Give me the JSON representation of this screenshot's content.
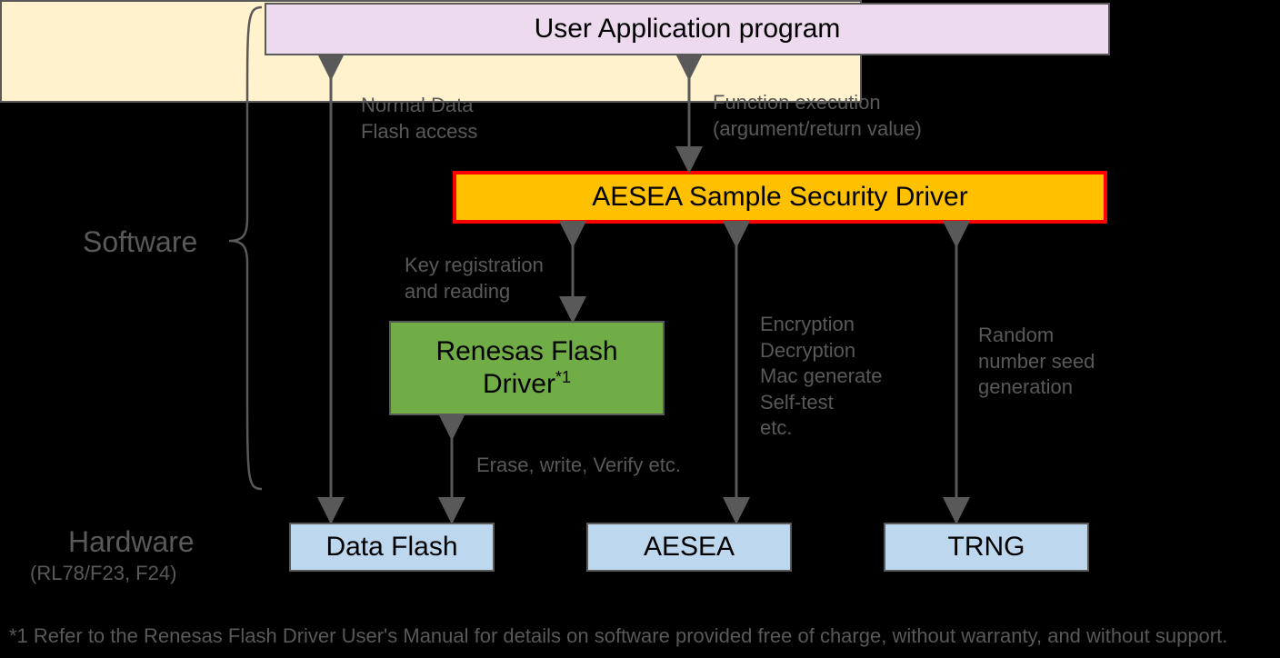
{
  "sections": {
    "software": "Software",
    "hardware": "Hardware",
    "hardware_sub": "(RL78/F23, F24)"
  },
  "boxes": {
    "user_app": "User Application program",
    "aesea_driver": "AESEA Sample Security Driver",
    "renesas_flash_line1": "Renesas Flash",
    "renesas_flash_line2": "Driver",
    "renesas_flash_sup": "*1",
    "data_flash": "Data Flash",
    "aesea_hw": "AESEA",
    "trng": "TRNG"
  },
  "labels": {
    "normal_data": "Normal Data\nFlash access",
    "function_exec": "Function execution\n(argument/return value)",
    "key_reg": "Key registration\nand reading",
    "encryption": "Encryption\nDecryption\nMac generate\nSelf-test\netc.",
    "random": "Random\nnumber seed\ngeneration",
    "erase": "Erase, write, Verify etc."
  },
  "footnote": "*1 Refer to the Renesas Flash Driver User's Manual for details on software provided free of charge, without warranty, and without support."
}
